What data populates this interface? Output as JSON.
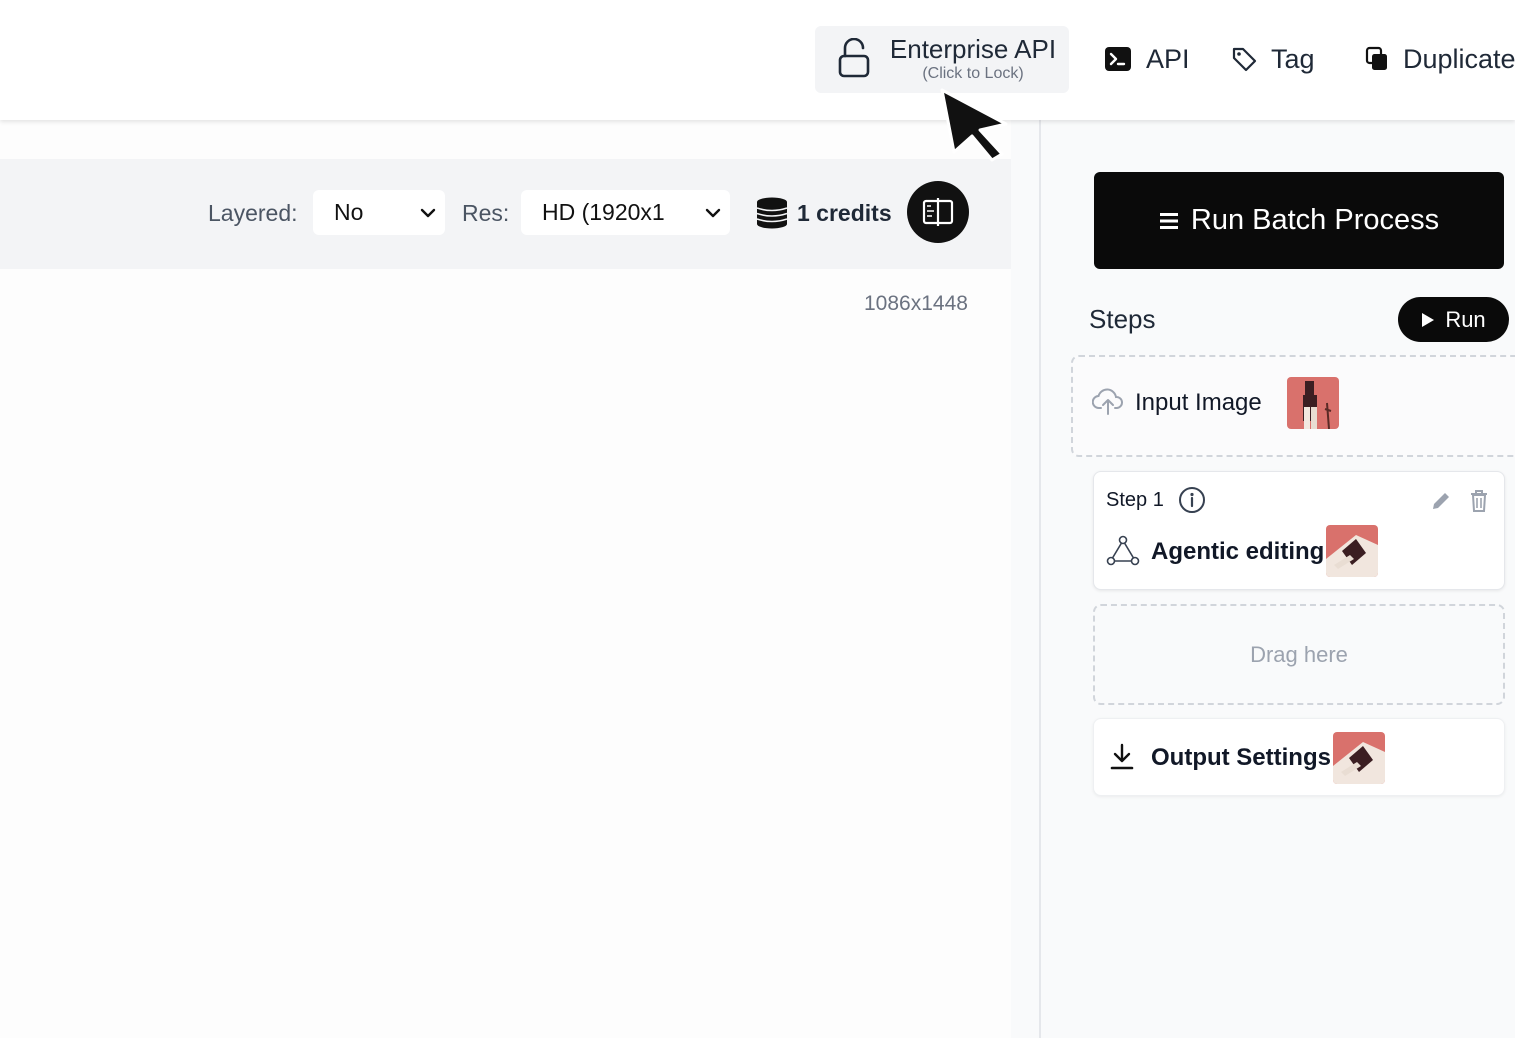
{
  "header": {
    "enterprise_api": {
      "title": "Enterprise API",
      "subtitle": "(Click to Lock)"
    },
    "api_label": "API",
    "tag_label": "Tag",
    "duplicate_label": "Duplicate"
  },
  "toolbar": {
    "layered_label": "Layered:",
    "layered_value": "No",
    "res_label": "Res:",
    "res_value": "HD (1920x1",
    "credits": "1 credits"
  },
  "canvas": {
    "dimensions": "1086x1448"
  },
  "panel": {
    "run_batch_label": "Run Batch Process",
    "steps_title": "Steps",
    "run_label": "Run",
    "input_step": {
      "label": "Input Image",
      "icon": "upload-cloud-icon"
    },
    "step1": {
      "index_label": "Step 1",
      "name": "Agentic editing",
      "icon": "graph-nodes-icon"
    },
    "drop_zone": "Drag here",
    "output": {
      "label": "Output Settings",
      "icon": "download-icon"
    }
  },
  "colors": {
    "primary_black": "#0a0a0a",
    "toolbar_bg": "#f3f4f6",
    "muted_text": "#6b7280",
    "thumb_pink": "#d9716c"
  }
}
